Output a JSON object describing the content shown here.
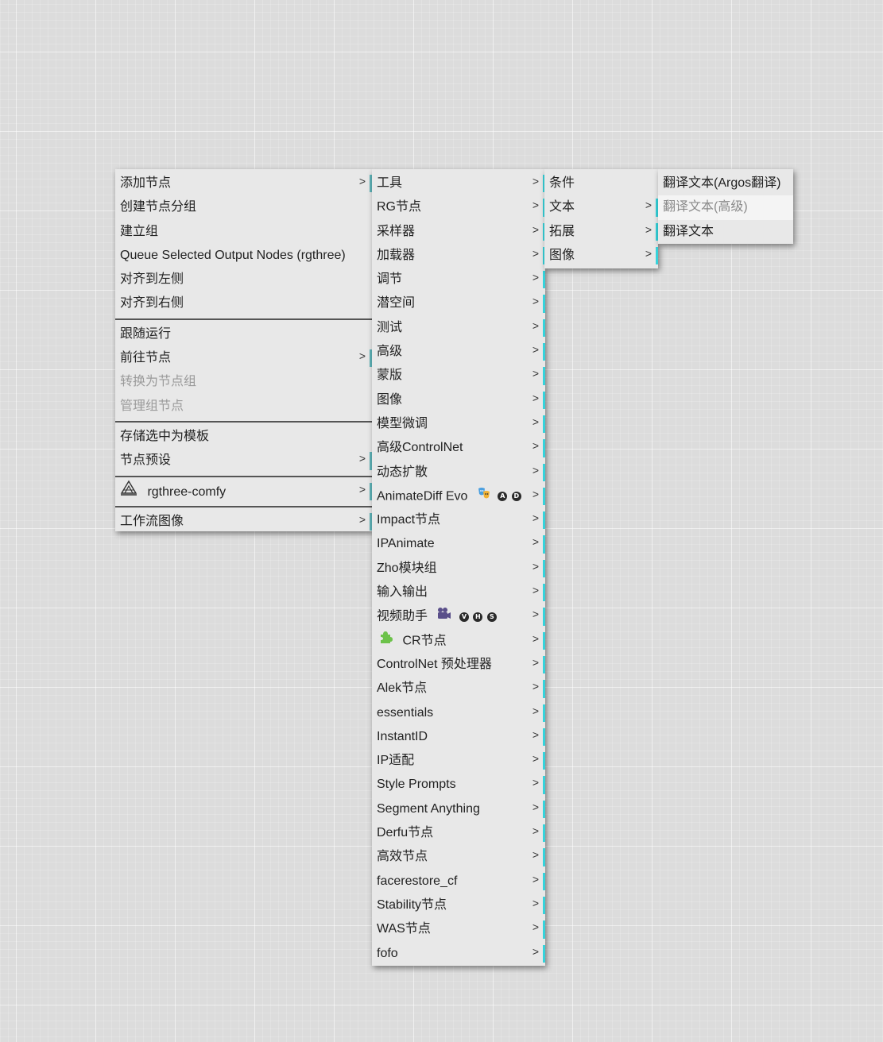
{
  "menu_main": {
    "items": [
      {
        "label": "添加节点",
        "arrow": ">"
      },
      {
        "label": "创建节点分组"
      },
      {
        "label": "建立组"
      },
      {
        "label": "Queue Selected Output Nodes (rgthree)"
      },
      {
        "label": "对齐到左侧"
      },
      {
        "label": "对齐到右侧"
      },
      {
        "label": "跟随运行"
      },
      {
        "label": "前往节点",
        "arrow": ">"
      },
      {
        "label": "转换为节点组"
      },
      {
        "label": "管理组节点"
      },
      {
        "label": "存储选中为模板"
      },
      {
        "label": "节点预设",
        "arrow": ">"
      },
      {
        "label": "rgthree-comfy",
        "arrow": ">"
      },
      {
        "label": "工作流图像",
        "arrow": ">"
      }
    ]
  },
  "menu_nodes": {
    "items": [
      {
        "label": "工具",
        "arrow": ">"
      },
      {
        "label": "RG节点",
        "arrow": ">"
      },
      {
        "label": "采样器",
        "arrow": ">"
      },
      {
        "label": "加载器",
        "arrow": ">"
      },
      {
        "label": "调节",
        "arrow": ">"
      },
      {
        "label": "潜空间",
        "arrow": ">"
      },
      {
        "label": "测试",
        "arrow": ">"
      },
      {
        "label": "高级",
        "arrow": ">"
      },
      {
        "label": "蒙版",
        "arrow": ">"
      },
      {
        "label": "图像",
        "arrow": ">"
      },
      {
        "label": "模型微调",
        "arrow": ">"
      },
      {
        "label": "高级ControlNet",
        "arrow": ">"
      },
      {
        "label": "动态扩散",
        "arrow": ">"
      },
      {
        "label": "AnimateDiff Evo",
        "badges": [
          "A",
          "D"
        ],
        "arrow": ">"
      },
      {
        "label": "Impact节点",
        "arrow": ">"
      },
      {
        "label": "IPAnimate",
        "arrow": ">"
      },
      {
        "label": "Zho模块组",
        "arrow": ">"
      },
      {
        "label": "输入输出",
        "arrow": ">"
      },
      {
        "label": "视频助手",
        "badges": [
          "V",
          "H",
          "S"
        ],
        "arrow": ">"
      },
      {
        "label": "CR节点",
        "arrow": ">"
      },
      {
        "label": "ControlNet 预处理器",
        "arrow": ">"
      },
      {
        "label": "Alek节点",
        "arrow": ">"
      },
      {
        "label": "essentials",
        "arrow": ">"
      },
      {
        "label": "InstantID",
        "arrow": ">"
      },
      {
        "label": "IP适配",
        "arrow": ">"
      },
      {
        "label": "Style Prompts",
        "arrow": ">"
      },
      {
        "label": "Segment Anything",
        "arrow": ">"
      },
      {
        "label": "Derfu节点",
        "arrow": ">"
      },
      {
        "label": "高效节点",
        "arrow": ">"
      },
      {
        "label": "facerestore_cf",
        "arrow": ">"
      },
      {
        "label": "Stability节点",
        "arrow": ">"
      },
      {
        "label": "WAS节点",
        "arrow": ">"
      },
      {
        "label": "fofo",
        "arrow": ">"
      }
    ]
  },
  "menu_tools": {
    "items": [
      {
        "label": "条件"
      },
      {
        "label": "文本",
        "arrow": ">"
      },
      {
        "label": "拓展",
        "arrow": ">"
      },
      {
        "label": "图像",
        "arrow": ">"
      }
    ]
  },
  "menu_text": {
    "items": [
      {
        "label": "翻译文本(Argos翻译)"
      },
      {
        "label": "翻译文本(高级)"
      },
      {
        "label": "翻译文本"
      }
    ]
  }
}
